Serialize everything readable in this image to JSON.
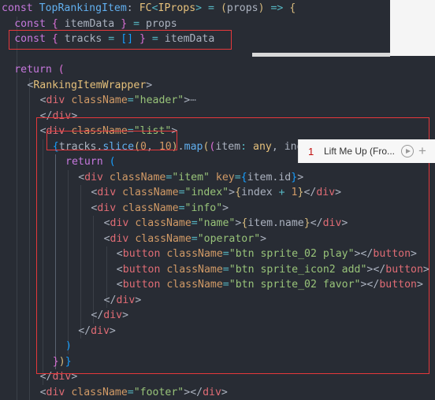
{
  "editor": {
    "lines": [
      {
        "indent": 0,
        "tokens": [
          [
            "kw",
            "const "
          ],
          [
            "fn",
            "TopRankingItem"
          ],
          [
            "pl",
            ": "
          ],
          [
            "ty",
            "FC"
          ],
          [
            "op",
            "<"
          ],
          [
            "ty",
            "IProps"
          ],
          [
            "op",
            "> = "
          ],
          [
            "br1",
            "("
          ],
          [
            "pl",
            "props"
          ],
          [
            "br1",
            ")"
          ],
          [
            "op",
            " => "
          ],
          [
            "br1",
            "{"
          ]
        ]
      },
      {
        "indent": 1,
        "tokens": [
          [
            "kw",
            "const "
          ],
          [
            "br2",
            "{ "
          ],
          [
            "pl",
            "itemData "
          ],
          [
            "br2",
            "}"
          ],
          [
            "op",
            " = "
          ],
          [
            "pl",
            "props"
          ]
        ]
      },
      {
        "indent": 1,
        "tokens": [
          [
            "kw",
            "const "
          ],
          [
            "br2",
            "{ "
          ],
          [
            "pl",
            "tracks "
          ],
          [
            "op",
            "= "
          ],
          [
            "br3",
            "[]"
          ],
          [
            "br2",
            " }"
          ],
          [
            "op",
            " = "
          ],
          [
            "pl",
            "itemData"
          ]
        ]
      },
      {
        "indent": 0,
        "tokens": []
      },
      {
        "indent": 1,
        "tokens": [
          [
            "kw",
            "return "
          ],
          [
            "br2",
            "("
          ]
        ]
      },
      {
        "indent": 2,
        "tokens": [
          [
            "pl",
            "<"
          ],
          [
            "ty",
            "RankingItemWrapper"
          ],
          [
            "pl",
            ">"
          ]
        ]
      },
      {
        "indent": 3,
        "tokens": [
          [
            "pl",
            "<"
          ],
          [
            "tag",
            "div "
          ],
          [
            "attr",
            "className"
          ],
          [
            "op",
            "="
          ],
          [
            "str",
            "\"header\""
          ],
          [
            "pl",
            ">"
          ],
          [
            "fold",
            "⋯"
          ]
        ]
      },
      {
        "indent": 3,
        "tokens": [
          [
            "pl",
            "</"
          ],
          [
            "tag",
            "div"
          ],
          [
            "pl",
            ">"
          ]
        ]
      },
      {
        "indent": 3,
        "tokens": [
          [
            "pl",
            "<"
          ],
          [
            "tag",
            "div "
          ],
          [
            "attr",
            "className"
          ],
          [
            "op",
            "="
          ],
          [
            "str",
            "\"list\""
          ],
          [
            "pl",
            ">"
          ]
        ]
      },
      {
        "indent": 4,
        "tokens": [
          [
            "br3",
            "{"
          ],
          [
            "pl",
            "tracks."
          ],
          [
            "fn",
            "slice"
          ],
          [
            "br1",
            "("
          ],
          [
            "num",
            "0"
          ],
          [
            "pl",
            ", "
          ],
          [
            "num",
            "10"
          ],
          [
            "br1",
            ")"
          ],
          [
            "pl",
            "."
          ],
          [
            "fn",
            "map"
          ],
          [
            "br1",
            "("
          ],
          [
            "br2",
            "("
          ],
          [
            "pl",
            "item"
          ],
          [
            "op",
            ": "
          ],
          [
            "ty",
            "any"
          ],
          [
            "pl",
            ", ind"
          ]
        ]
      },
      {
        "indent": 5,
        "tokens": [
          [
            "kw",
            "return "
          ],
          [
            "br3",
            "("
          ]
        ]
      },
      {
        "indent": 6,
        "tokens": [
          [
            "pl",
            "<"
          ],
          [
            "tag",
            "div "
          ],
          [
            "attr",
            "className"
          ],
          [
            "op",
            "="
          ],
          [
            "str",
            "\"item\""
          ],
          [
            "pl",
            " "
          ],
          [
            "attr",
            "key"
          ],
          [
            "op",
            "="
          ],
          [
            "br3",
            "{"
          ],
          [
            "pl",
            "item.id"
          ],
          [
            "br3",
            "}"
          ],
          [
            "pl",
            ">"
          ]
        ]
      },
      {
        "indent": 7,
        "tokens": [
          [
            "pl",
            "<"
          ],
          [
            "tag",
            "div "
          ],
          [
            "attr",
            "className"
          ],
          [
            "op",
            "="
          ],
          [
            "str",
            "\"index\""
          ],
          [
            "pl",
            ">"
          ],
          [
            "br1",
            "{"
          ],
          [
            "pl",
            "index "
          ],
          [
            "op",
            "+ "
          ],
          [
            "num",
            "1"
          ],
          [
            "br1",
            "}"
          ],
          [
            "pl",
            "</"
          ],
          [
            "tag",
            "div"
          ],
          [
            "pl",
            ">"
          ]
        ]
      },
      {
        "indent": 7,
        "tokens": [
          [
            "pl",
            "<"
          ],
          [
            "tag",
            "div "
          ],
          [
            "attr",
            "className"
          ],
          [
            "op",
            "="
          ],
          [
            "str",
            "\"info\""
          ],
          [
            "pl",
            ">"
          ]
        ]
      },
      {
        "indent": 8,
        "tokens": [
          [
            "pl",
            "<"
          ],
          [
            "tag",
            "div "
          ],
          [
            "attr",
            "className"
          ],
          [
            "op",
            "="
          ],
          [
            "str",
            "\"name\""
          ],
          [
            "pl",
            ">"
          ],
          [
            "br1",
            "{"
          ],
          [
            "pl",
            "item.name"
          ],
          [
            "br1",
            "}"
          ],
          [
            "pl",
            "</"
          ],
          [
            "tag",
            "div"
          ],
          [
            "pl",
            ">"
          ]
        ]
      },
      {
        "indent": 8,
        "tokens": [
          [
            "pl",
            "<"
          ],
          [
            "tag",
            "div "
          ],
          [
            "attr",
            "className"
          ],
          [
            "op",
            "="
          ],
          [
            "str",
            "\"operator\""
          ],
          [
            "pl",
            ">"
          ]
        ]
      },
      {
        "indent": 9,
        "tokens": [
          [
            "pl",
            "<"
          ],
          [
            "tag",
            "button "
          ],
          [
            "attr",
            "className"
          ],
          [
            "op",
            "="
          ],
          [
            "str",
            "\"btn sprite_02 play\""
          ],
          [
            "pl",
            "></"
          ],
          [
            "tag",
            "button"
          ],
          [
            "pl",
            ">"
          ]
        ]
      },
      {
        "indent": 9,
        "tokens": [
          [
            "pl",
            "<"
          ],
          [
            "tag",
            "button "
          ],
          [
            "attr",
            "className"
          ],
          [
            "op",
            "="
          ],
          [
            "str",
            "\"btn sprite_icon2 add\""
          ],
          [
            "pl",
            "></"
          ],
          [
            "tag",
            "button"
          ],
          [
            "pl",
            ">"
          ]
        ]
      },
      {
        "indent": 9,
        "tokens": [
          [
            "pl",
            "<"
          ],
          [
            "tag",
            "button "
          ],
          [
            "attr",
            "className"
          ],
          [
            "op",
            "="
          ],
          [
            "str",
            "\"btn sprite_02 favor\""
          ],
          [
            "pl",
            "></"
          ],
          [
            "tag",
            "button"
          ],
          [
            "pl",
            ">"
          ]
        ]
      },
      {
        "indent": 8,
        "tokens": [
          [
            "pl",
            "</"
          ],
          [
            "tag",
            "div"
          ],
          [
            "pl",
            ">"
          ]
        ]
      },
      {
        "indent": 7,
        "tokens": [
          [
            "pl",
            "</"
          ],
          [
            "tag",
            "div"
          ],
          [
            "pl",
            ">"
          ]
        ]
      },
      {
        "indent": 6,
        "tokens": [
          [
            "pl",
            "</"
          ],
          [
            "tag",
            "div"
          ],
          [
            "pl",
            ">"
          ]
        ]
      },
      {
        "indent": 5,
        "tokens": [
          [
            "br3",
            ")"
          ]
        ]
      },
      {
        "indent": 4,
        "tokens": [
          [
            "br2",
            "}"
          ],
          [
            "br1",
            ")"
          ],
          [
            "br3",
            "}"
          ]
        ]
      },
      {
        "indent": 3,
        "tokens": [
          [
            "pl",
            "</"
          ],
          [
            "tag",
            "div"
          ],
          [
            "pl",
            ">"
          ]
        ]
      },
      {
        "indent": 3,
        "tokens": [
          [
            "pl",
            "<"
          ],
          [
            "tag",
            "div "
          ],
          [
            "attr",
            "className"
          ],
          [
            "op",
            "="
          ],
          [
            "str",
            "\"footer\""
          ],
          [
            "pl",
            "></"
          ],
          [
            "tag",
            "div"
          ],
          [
            "pl",
            ">"
          ]
        ]
      }
    ]
  },
  "preview": {
    "index": "1",
    "song": "Lift Me Up (Fro...",
    "play_icon": "play-circle-icon",
    "add_icon": "plus-icon"
  }
}
